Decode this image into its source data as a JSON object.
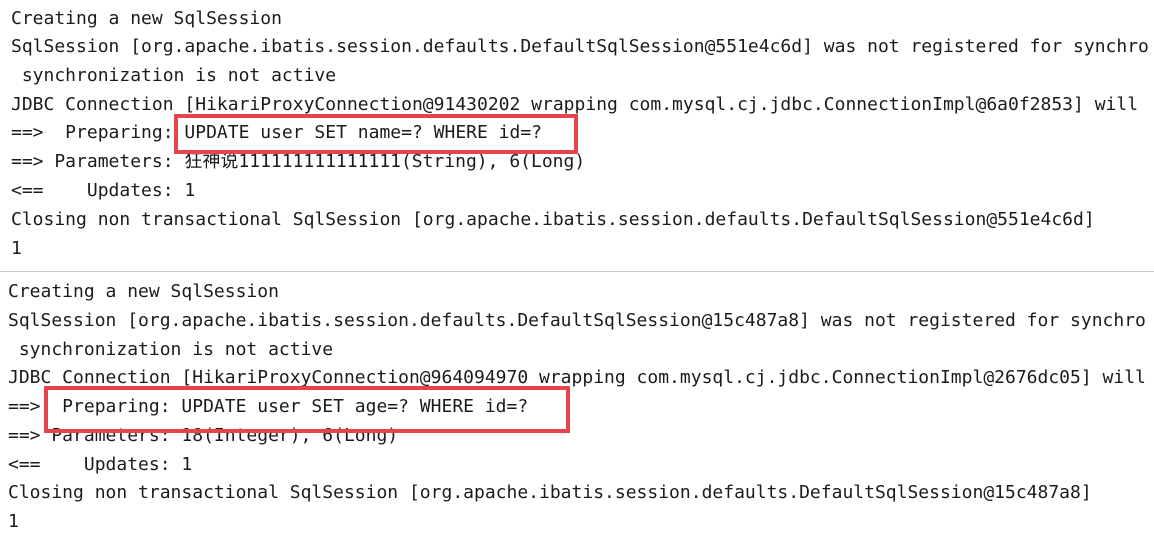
{
  "accent_color": "#e8424a",
  "top_log": {
    "lines": [
      "Creating a new SqlSession",
      "SqlSession [org.apache.ibatis.session.defaults.DefaultSqlSession@551e4c6d] was not registered for synchro",
      " synchronization is not active",
      "JDBC Connection [HikariProxyConnection@91430202 wrapping com.mysql.cj.jdbc.ConnectionImpl@6a0f2853] will",
      "==>  Preparing: UPDATE user SET name=? WHERE id=?",
      "==> Parameters: 狂神说111111111111111(String), 6(Long)",
      "<==    Updates: 1",
      "Closing non transactional SqlSession [org.apache.ibatis.session.defaults.DefaultSqlSession@551e4c6d]",
      "1"
    ]
  },
  "bottom_log": {
    "lines": [
      "Creating a new SqlSession",
      "SqlSession [org.apache.ibatis.session.defaults.DefaultSqlSession@15c487a8] was not registered for synchro",
      " synchronization is not active",
      "JDBC Connection [HikariProxyConnection@964094970 wrapping com.mysql.cj.jdbc.ConnectionImpl@2676dc05] will",
      "==>  Preparing: UPDATE user SET age=? WHERE id=?",
      "==> Parameters: 18(Integer), 6(Long)",
      "<==    Updates: 1",
      "Closing non transactional SqlSession [org.apache.ibatis.session.defaults.DefaultSqlSession@15c487a8]",
      "1"
    ]
  }
}
